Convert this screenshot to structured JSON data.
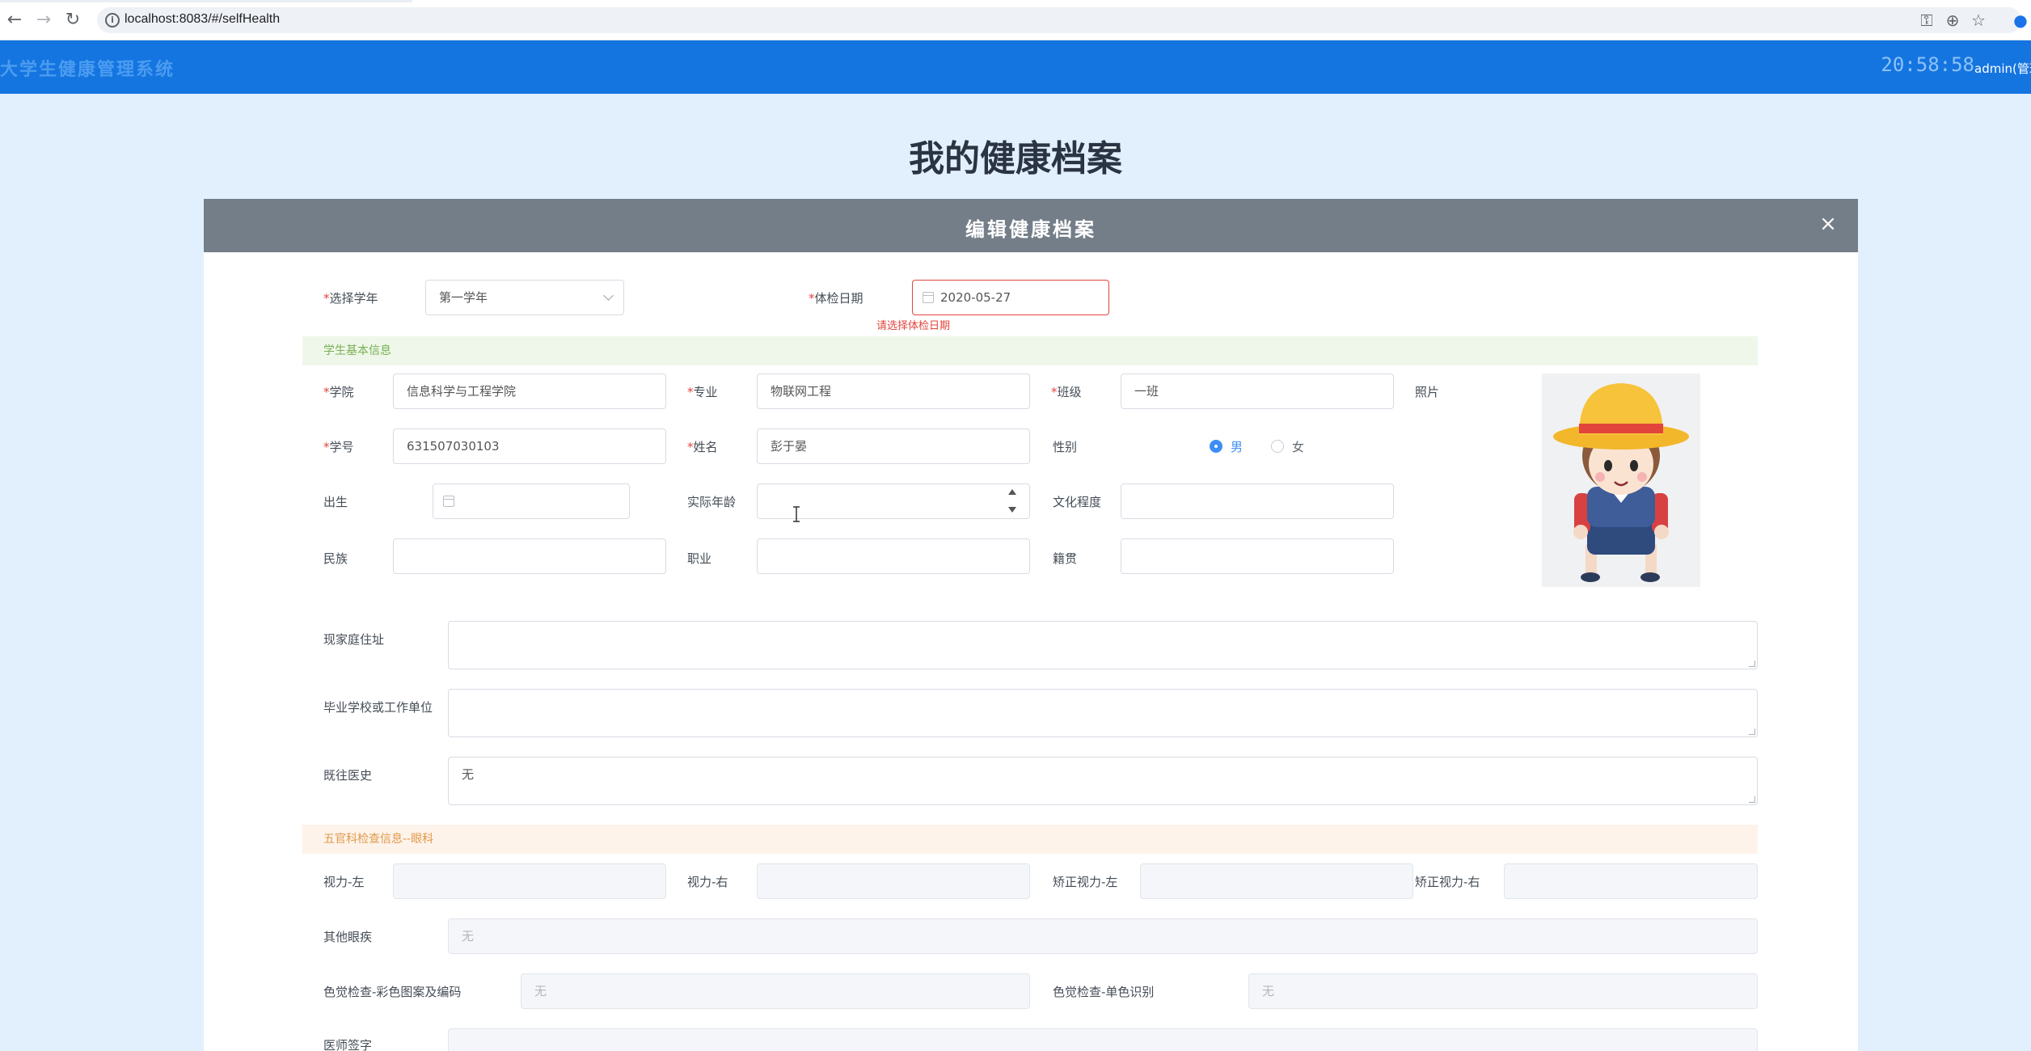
{
  "browser": {
    "url": "localhost:8083/#/selfHealth",
    "back_icon": "←",
    "forward_icon": "→",
    "reload_icon": "↻",
    "info_icon": "i",
    "key_icon": "⚿",
    "zoom_icon": "⊕",
    "star_icon": "☆",
    "profile_icon": "●"
  },
  "app": {
    "title": "大学生健康管理系统",
    "clock": "20:58:58",
    "user": "admin(管理员)"
  },
  "page": {
    "title": "我的健康档案"
  },
  "dialog": {
    "title": "编辑健康档案",
    "close_icon": "×",
    "req_mark": "*",
    "school_year": {
      "label": "选择学年",
      "value": "第一学年"
    },
    "exam_date": {
      "label": "体检日期",
      "value": "2020-05-27",
      "error": "请选择体检日期"
    },
    "section_basic": "学生基本信息",
    "college": {
      "label": "学院",
      "value": "信息科学与工程学院"
    },
    "major": {
      "label": "专业",
      "value": "物联网工程"
    },
    "class": {
      "label": "班级",
      "value": "一班"
    },
    "photo_label": "照片",
    "student_id": {
      "label": "学号",
      "value": "631507030103"
    },
    "name": {
      "label": "姓名",
      "value": "彭于晏"
    },
    "gender": {
      "label": "性别",
      "option_male": "男",
      "option_female": "女",
      "selected": "男"
    },
    "birth": {
      "label": "出生",
      "value": ""
    },
    "age": {
      "label": "实际年龄",
      "value": ""
    },
    "education": {
      "label": "文化程度",
      "value": ""
    },
    "ethnicity": {
      "label": "民族",
      "value": ""
    },
    "occupation": {
      "label": "职业",
      "value": ""
    },
    "native_place": {
      "label": "籍贯",
      "value": ""
    },
    "address": {
      "label": "现家庭住址",
      "value": ""
    },
    "school_work": {
      "label": "毕业学校或工作单位",
      "value": ""
    },
    "medical_history": {
      "label": "既往医史",
      "value": "无"
    },
    "section_eye": "五官科检查信息--眼科",
    "vision_left": {
      "label": "视力-左",
      "value": ""
    },
    "vision_right": {
      "label": "视力-右",
      "value": ""
    },
    "corrected_left": {
      "label": "矫正视力-左",
      "value": ""
    },
    "corrected_right": {
      "label": "矫正视力-右",
      "value": ""
    },
    "other_eye": {
      "label": "其他眼疾",
      "value": "无"
    },
    "color_pattern": {
      "label": "色觉检查-彩色图案及编码",
      "value": "无"
    },
    "color_single": {
      "label": "色觉检查-单色识别",
      "value": "无"
    },
    "doctor_sign": {
      "label": "医师签字",
      "value": ""
    }
  },
  "colors": {
    "header_blue": "#1475e1",
    "dialog_header": "#747e88",
    "page_bg": "#e2f0fd",
    "error_red": "#e2453c",
    "radio_blue": "#3d8ef3"
  }
}
